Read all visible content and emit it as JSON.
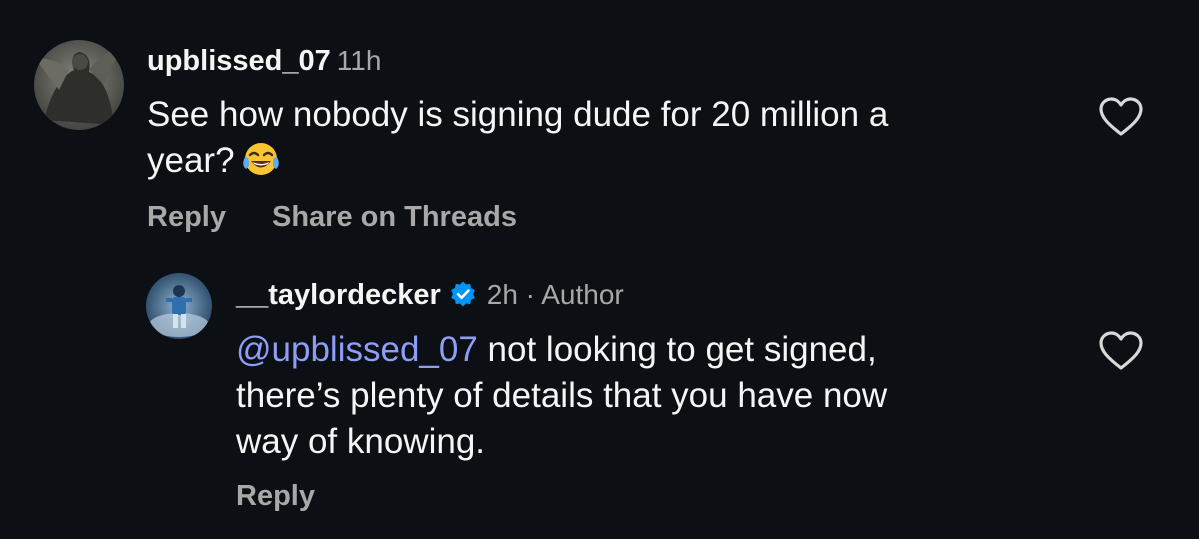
{
  "comments": [
    {
      "username": "upblissed_07",
      "time": "11h",
      "text_line1": "See how nobody is signing dude for 20 million a",
      "text_line2": "year?",
      "emoji_icon": "face-with-tears-of-joy-emoji",
      "reply_label": "Reply",
      "share_label": "Share on Threads",
      "avatar_icon": "statue-avatar"
    },
    {
      "username": "__taylordecker",
      "verified_icon": "verified-badge-icon",
      "time": "2h · Author",
      "mention": "@upblissed_07",
      "text_line1_rest": " not looking to get signed,",
      "text_line2": "there’s plenty of details that you have now",
      "text_line3": "way of knowing.",
      "reply_label": "Reply",
      "avatar_icon": "football-player-avatar"
    }
  ],
  "colors": {
    "background": "#0c0f14",
    "primary_text": "#f5f5f5",
    "secondary_text": "#a8a8a8",
    "mention": "#8e9df6",
    "verified": "#0095f6"
  }
}
